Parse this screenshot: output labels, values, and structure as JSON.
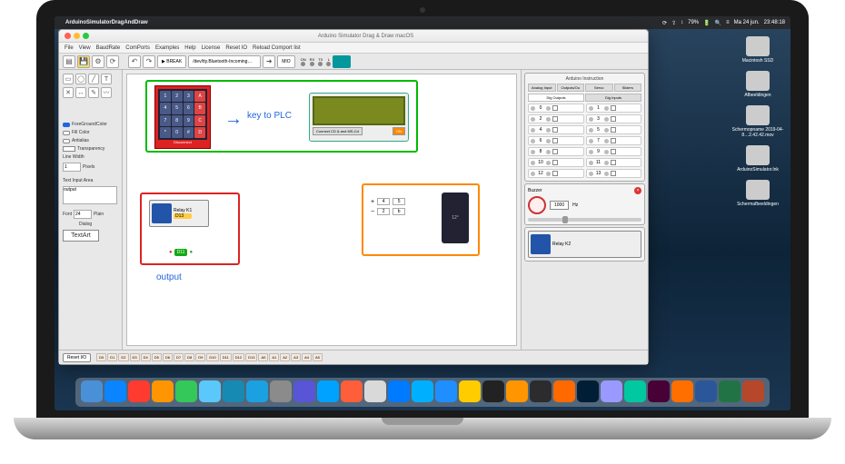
{
  "macos": {
    "menubar_app": "ArduinoSimulatorDragAndDraw",
    "status_items": [
      "⟳",
      "⇪",
      "↕",
      "79%",
      "🔋",
      "🔍",
      "≡",
      "Ma 24 jun.",
      "23:48:18"
    ],
    "desktop": [
      {
        "label": "Macintosh SSD"
      },
      {
        "label": "Afbeeldingen"
      },
      {
        "label": "Schermopname 2019-04-8…2.42.42.mov"
      },
      {
        "label": "ArduinoSimulator.lnk"
      },
      {
        "label": "Schermafbeeldingen"
      }
    ]
  },
  "window": {
    "title": "Arduino Simulator Drag & Draw macOS",
    "menu": [
      "File",
      "View",
      "BaudRate",
      "ComPorts",
      "Examples",
      "Help",
      "License",
      "Reset IO",
      "Reload Comport list"
    ]
  },
  "toolbar": {
    "break": "▶ BREAK",
    "port": "/dev/tty.Bluetooth-Incoming…",
    "mio": "MIO",
    "leds": [
      "ON",
      "RX",
      "TX",
      "L"
    ]
  },
  "left_panel": {
    "props": [
      "ForeGroundColor",
      "Fill Color",
      "Antialias"
    ],
    "transparency": "Transparency",
    "line_width": "Line Width",
    "line_width_value": "1",
    "pixels": "Pixels",
    "text_input_label": "Text Input Area",
    "text_input_value": "output",
    "font_label": "Font",
    "font_size": "24",
    "font_style": "Plain",
    "font_family": "Dialog",
    "textart": "TextArt"
  },
  "canvas": {
    "text1": "key to PLC",
    "text2": "output",
    "keypad": [
      "1",
      "2",
      "3",
      "A",
      "4",
      "5",
      "6",
      "B",
      "7",
      "8",
      "9",
      "C",
      "*",
      "0",
      "#",
      "D"
    ],
    "keypad_label": "Disconnect",
    "lcd_footer_left": "Connect CD & and MS-Cd",
    "lcd_footer_right": "ON",
    "relay1": {
      "label": "Relay K1",
      "pin": "D13"
    },
    "dig_pin": "D11",
    "stepper": {
      "plus": "+",
      "minus": "−",
      "v1": "4",
      "v2": "5",
      "s1": "2",
      "s2": "b",
      "motor": "12°"
    }
  },
  "right_panel": {
    "title": "Arduino Instruction",
    "tabs_row1": [
      "Analog Input",
      "Outputs/Ou",
      "Servo",
      "Sliders"
    ],
    "tabs_row2": [
      "Dig Outputs",
      "Dig Inputs"
    ],
    "io_pins": [
      0,
      1,
      2,
      3,
      4,
      5,
      6,
      7,
      8,
      9,
      10,
      11,
      12,
      13
    ],
    "buzzer": {
      "title": "Buzzer",
      "freq": "1000",
      "unit": "Hz"
    },
    "relay2": {
      "label": "Relay K2"
    }
  },
  "bottom": {
    "reset": "Reset I/O",
    "pins": [
      "D0",
      "D1",
      "D2",
      "D3",
      "D4",
      "D5",
      "D6",
      "D7",
      "D8",
      "D9",
      "D10",
      "D11",
      "D12",
      "D13",
      "A0",
      "A1",
      "A2",
      "A3",
      "A4",
      "A5"
    ]
  },
  "dock_colors": [
    "#4a90d9",
    "#0b84ff",
    "#ff3b30",
    "#ff9500",
    "#34c759",
    "#5ac8fa",
    "#178ab4",
    "#1ba1e2",
    "#8b8b8b",
    "#5856d6",
    "#00a2ff",
    "#ff5e3a",
    "#d9d9d9",
    "#007aff",
    "#00b0ff",
    "#1f8fff",
    "#ffcc00",
    "#222",
    "#ff9500",
    "#2c2c2e",
    "#ff6a00",
    "#001e36",
    "#9999ff",
    "#00c8a0",
    "#470137",
    "#ff6f00",
    "#2b579a",
    "#217346",
    "#b7472a"
  ]
}
